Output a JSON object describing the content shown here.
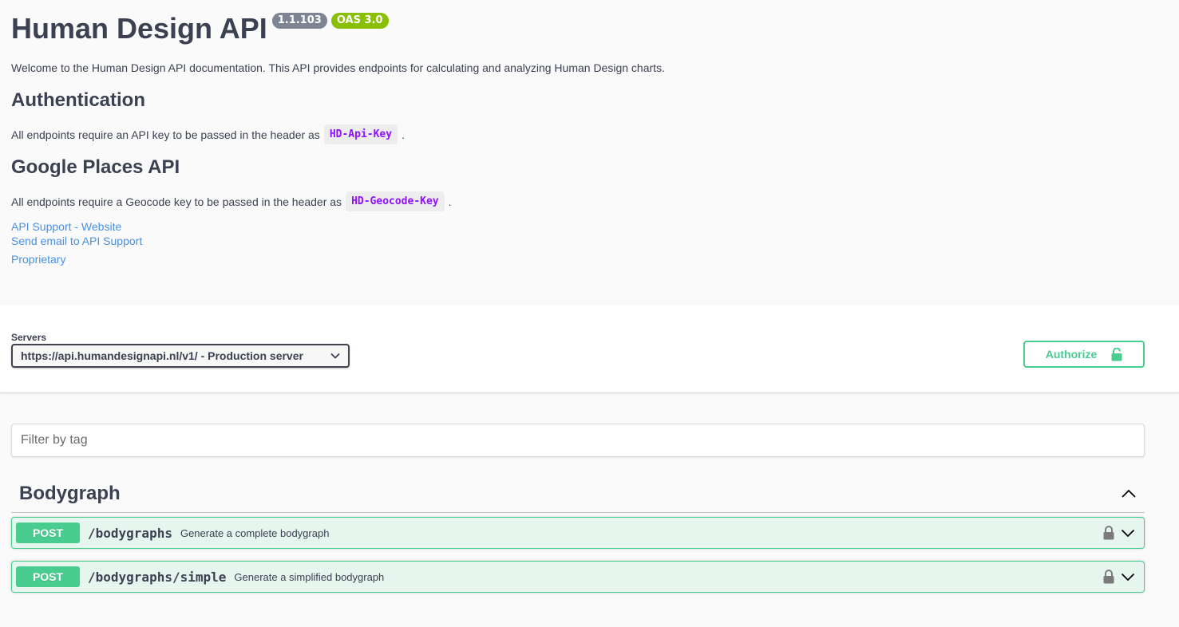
{
  "info": {
    "title": "Human Design API",
    "version": "1.1.103",
    "oas": "OAS 3.0",
    "description": "Welcome to the Human Design API documentation. This API provides endpoints for calculating and analyzing Human Design charts.",
    "auth_heading": "Authentication",
    "auth_text": "All endpoints require an API key to be passed in the header as",
    "auth_key": "HD-Api-Key",
    "places_heading": "Google Places API",
    "places_text": "All endpoints require a Geocode key to be passed in the header as",
    "places_key": "HD-Geocode-Key",
    "period": ".",
    "links": {
      "website": "API Support - Website",
      "email": "Send email to API Support",
      "license": "Proprietary"
    }
  },
  "servers": {
    "label": "Servers",
    "selected": "https://api.humandesignapi.nl/v1/ - Production server"
  },
  "authorize": {
    "label": "Authorize"
  },
  "filter": {
    "placeholder": "Filter by tag"
  },
  "tag": {
    "name": "Bodygraph"
  },
  "operations": [
    {
      "method": "POST",
      "path": "/bodygraphs",
      "summary": "Generate a complete bodygraph"
    },
    {
      "method": "POST",
      "path": "/bodygraphs/simple",
      "summary": "Generate a simplified bodygraph"
    }
  ],
  "colors": {
    "post": "#49cc90",
    "link": "#4990e2",
    "code": "#9012fe",
    "version_badge": "#7d8492",
    "oas_badge": "#89bf04"
  }
}
